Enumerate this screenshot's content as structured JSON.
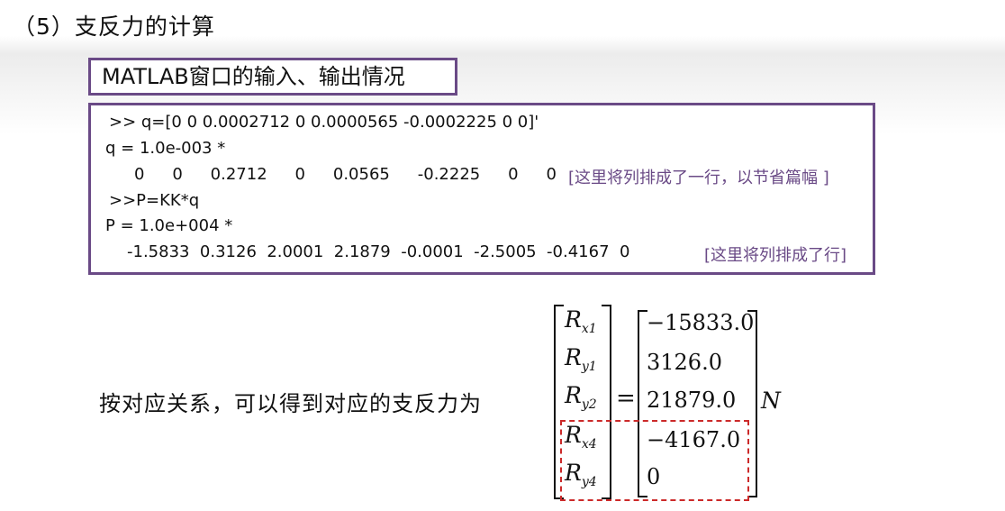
{
  "section_title": "（5）支反力的计算",
  "window_label": "MATLAB窗口的输入、输出情况",
  "console": {
    "line1": ">> q=[0 0 0.0002712 0 0.0000565 -0.0002225 0 0]'",
    "line2": "q = 1.0e-003 *",
    "line3": "0    0    0.2712    0    0.0565    -0.2225    0    0",
    "note1": "[这里将列排成了一行，以节省篇幅 ]",
    "line4": ">>P=KK*q",
    "line5": "P = 1.0e+004 *",
    "line6": "-1.5833  0.3126  2.0001  2.1879  -0.0001  -2.5005  -0.4167  0",
    "note2": "[这里将列排成了行]"
  },
  "lead_text": "按对应关系，可以得到对应的支反力为",
  "matrix": {
    "vars": [
      {
        "base": "R",
        "sub": "x1"
      },
      {
        "base": "R",
        "sub": "y1"
      },
      {
        "base": "R",
        "sub": "y2"
      },
      {
        "base": "R",
        "sub": "x4"
      },
      {
        "base": "R",
        "sub": "y4"
      }
    ],
    "values": [
      "−15833.0",
      "3126.0",
      "21879.0",
      "−4167.0",
      "0"
    ],
    "equals": "=",
    "unit": "N"
  },
  "colors": {
    "frame": "#6a4a86",
    "note": "#6a4a86",
    "dashed_highlight": "#cc2a2a"
  }
}
